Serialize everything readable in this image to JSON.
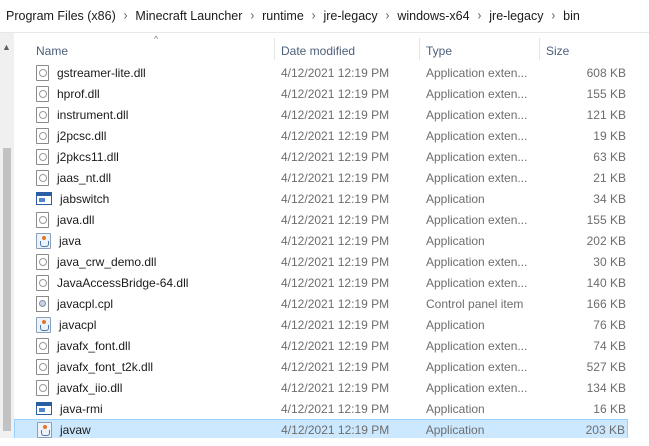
{
  "breadcrumb": [
    "Program Files (x86)",
    "Minecraft Launcher",
    "runtime",
    "jre-legacy",
    "windows-x64",
    "jre-legacy",
    "bin"
  ],
  "columns": {
    "name": "Name",
    "date": "Date modified",
    "type": "Type",
    "size": "Size"
  },
  "files": [
    {
      "name": "gstreamer-lite.dll",
      "date": "4/12/2021 12:19 PM",
      "type": "Application exten...",
      "size": "608 KB",
      "icon": "dll-icon"
    },
    {
      "name": "hprof.dll",
      "date": "4/12/2021 12:19 PM",
      "type": "Application exten...",
      "size": "155 KB",
      "icon": "dll-icon"
    },
    {
      "name": "instrument.dll",
      "date": "4/12/2021 12:19 PM",
      "type": "Application exten...",
      "size": "121 KB",
      "icon": "dll-icon"
    },
    {
      "name": "j2pcsc.dll",
      "date": "4/12/2021 12:19 PM",
      "type": "Application exten...",
      "size": "19 KB",
      "icon": "dll-icon"
    },
    {
      "name": "j2pkcs11.dll",
      "date": "4/12/2021 12:19 PM",
      "type": "Application exten...",
      "size": "63 KB",
      "icon": "dll-icon"
    },
    {
      "name": "jaas_nt.dll",
      "date": "4/12/2021 12:19 PM",
      "type": "Application exten...",
      "size": "21 KB",
      "icon": "dll-icon"
    },
    {
      "name": "jabswitch",
      "date": "4/12/2021 12:19 PM",
      "type": "Application",
      "size": "34 KB",
      "icon": "exe-icon"
    },
    {
      "name": "java.dll",
      "date": "4/12/2021 12:19 PM",
      "type": "Application exten...",
      "size": "155 KB",
      "icon": "dll-icon"
    },
    {
      "name": "java",
      "date": "4/12/2021 12:19 PM",
      "type": "Application",
      "size": "202 KB",
      "icon": "java-icon"
    },
    {
      "name": "java_crw_demo.dll",
      "date": "4/12/2021 12:19 PM",
      "type": "Application exten...",
      "size": "30 KB",
      "icon": "dll-icon"
    },
    {
      "name": "JavaAccessBridge-64.dll",
      "date": "4/12/2021 12:19 PM",
      "type": "Application exten...",
      "size": "140 KB",
      "icon": "dll-icon"
    },
    {
      "name": "javacpl.cpl",
      "date": "4/12/2021 12:19 PM",
      "type": "Control panel item",
      "size": "166 KB",
      "icon": "cpl-icon"
    },
    {
      "name": "javacpl",
      "date": "4/12/2021 12:19 PM",
      "type": "Application",
      "size": "76 KB",
      "icon": "java-icon"
    },
    {
      "name": "javafx_font.dll",
      "date": "4/12/2021 12:19 PM",
      "type": "Application exten...",
      "size": "74 KB",
      "icon": "dll-icon"
    },
    {
      "name": "javafx_font_t2k.dll",
      "date": "4/12/2021 12:19 PM",
      "type": "Application exten...",
      "size": "527 KB",
      "icon": "dll-icon"
    },
    {
      "name": "javafx_iio.dll",
      "date": "4/12/2021 12:19 PM",
      "type": "Application exten...",
      "size": "134 KB",
      "icon": "dll-icon"
    },
    {
      "name": "java-rmi",
      "date": "4/12/2021 12:19 PM",
      "type": "Application",
      "size": "16 KB",
      "icon": "exe-icon"
    },
    {
      "name": "javaw",
      "date": "4/12/2021 12:19 PM",
      "type": "Application",
      "size": "203 KB",
      "icon": "java-icon",
      "selected": true
    }
  ]
}
